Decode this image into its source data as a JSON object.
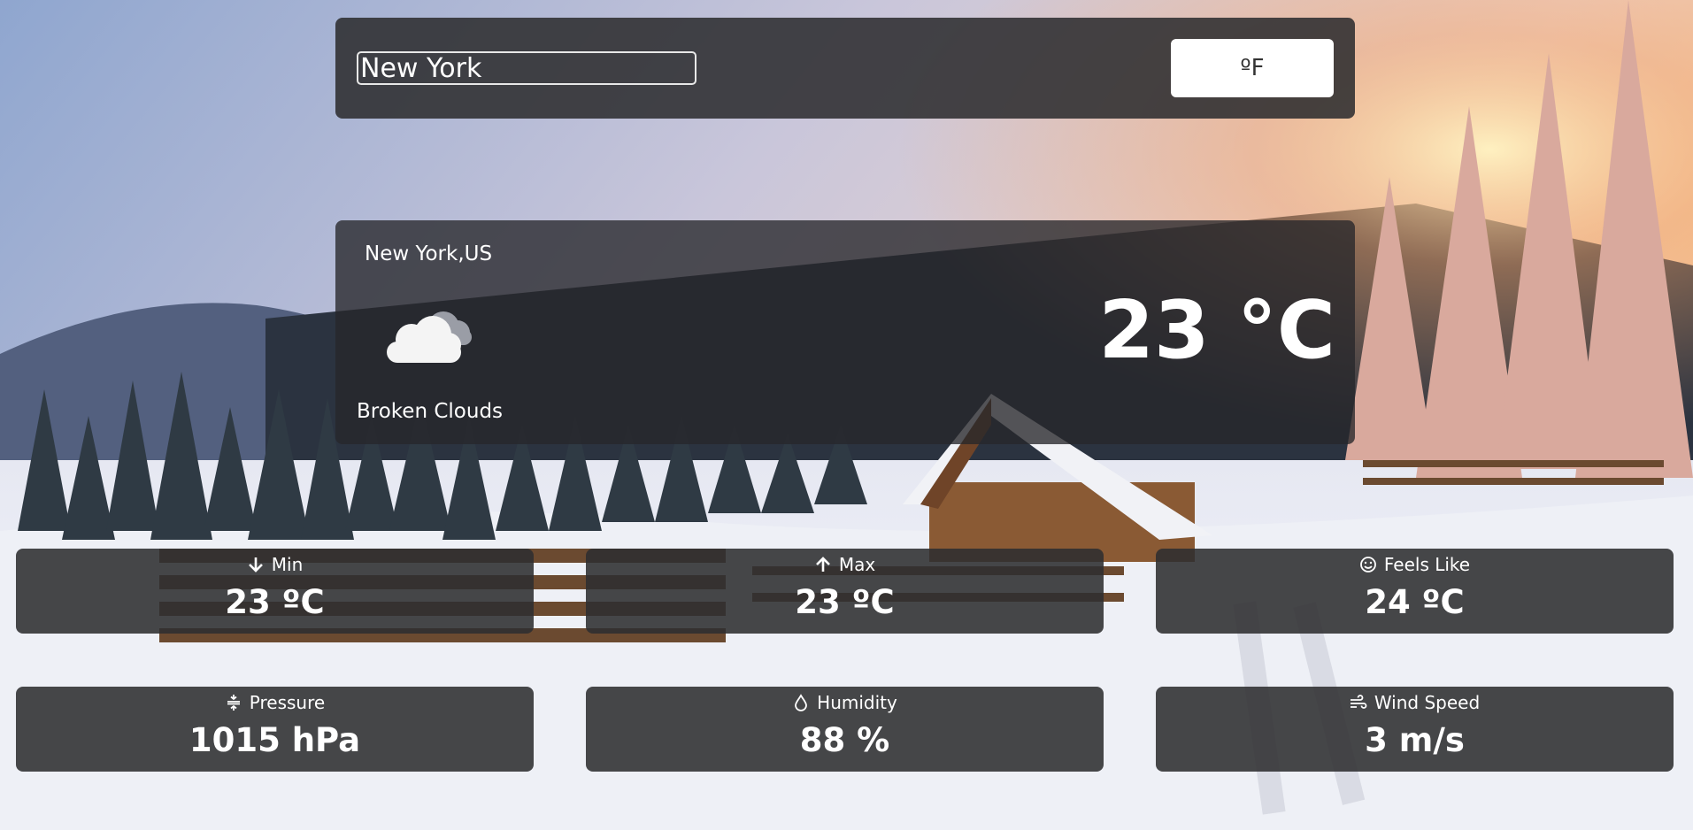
{
  "search": {
    "value": "New York"
  },
  "unit_toggle": {
    "label": "ºF"
  },
  "current": {
    "location": "New York,US",
    "icon": "broken-clouds-icon",
    "description": "Broken Clouds",
    "temperature": "23 °C"
  },
  "stats": {
    "min": {
      "label": "Min",
      "value": "23 ºC",
      "icon": "arrow-down-icon"
    },
    "max": {
      "label": "Max",
      "value": "23 ºC",
      "icon": "arrow-up-icon"
    },
    "feels_like": {
      "label": "Feels Like",
      "value": "24 ºC",
      "icon": "smile-icon"
    },
    "pressure": {
      "label": "Pressure",
      "value": "1015 hPa",
      "icon": "compress-icon"
    },
    "humidity": {
      "label": "Humidity",
      "value": "88 %",
      "icon": "droplet-icon"
    },
    "wind": {
      "label": "Wind Speed",
      "value": "3 m/s",
      "icon": "wind-icon"
    }
  }
}
